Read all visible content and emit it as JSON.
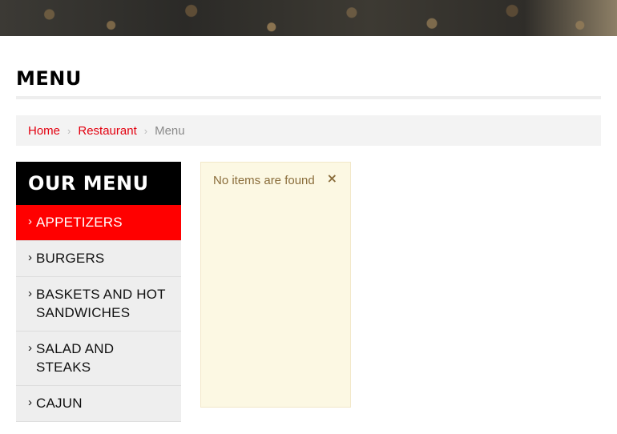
{
  "page": {
    "title": "MENU"
  },
  "breadcrumb": {
    "items": [
      "Home",
      "Restaurant"
    ],
    "separator": "›",
    "current": "Menu"
  },
  "sidebar": {
    "heading": "OUR MENU",
    "chevron": "›",
    "items": [
      {
        "label": "APPETIZERS",
        "active": true
      },
      {
        "label": "BURGERS",
        "active": false
      },
      {
        "label": "BASKETS AND HOT SANDWICHES",
        "active": false
      },
      {
        "label": "SALAD AND STEAKS",
        "active": false
      },
      {
        "label": "CAJUN",
        "active": false
      }
    ]
  },
  "alert": {
    "message": "No items are found",
    "close_symbol": "×"
  },
  "colors": {
    "accent": "#ff0000",
    "link": "#e3000f",
    "alert_bg": "#fcf8e3",
    "alert_text": "#8a6d3b"
  }
}
